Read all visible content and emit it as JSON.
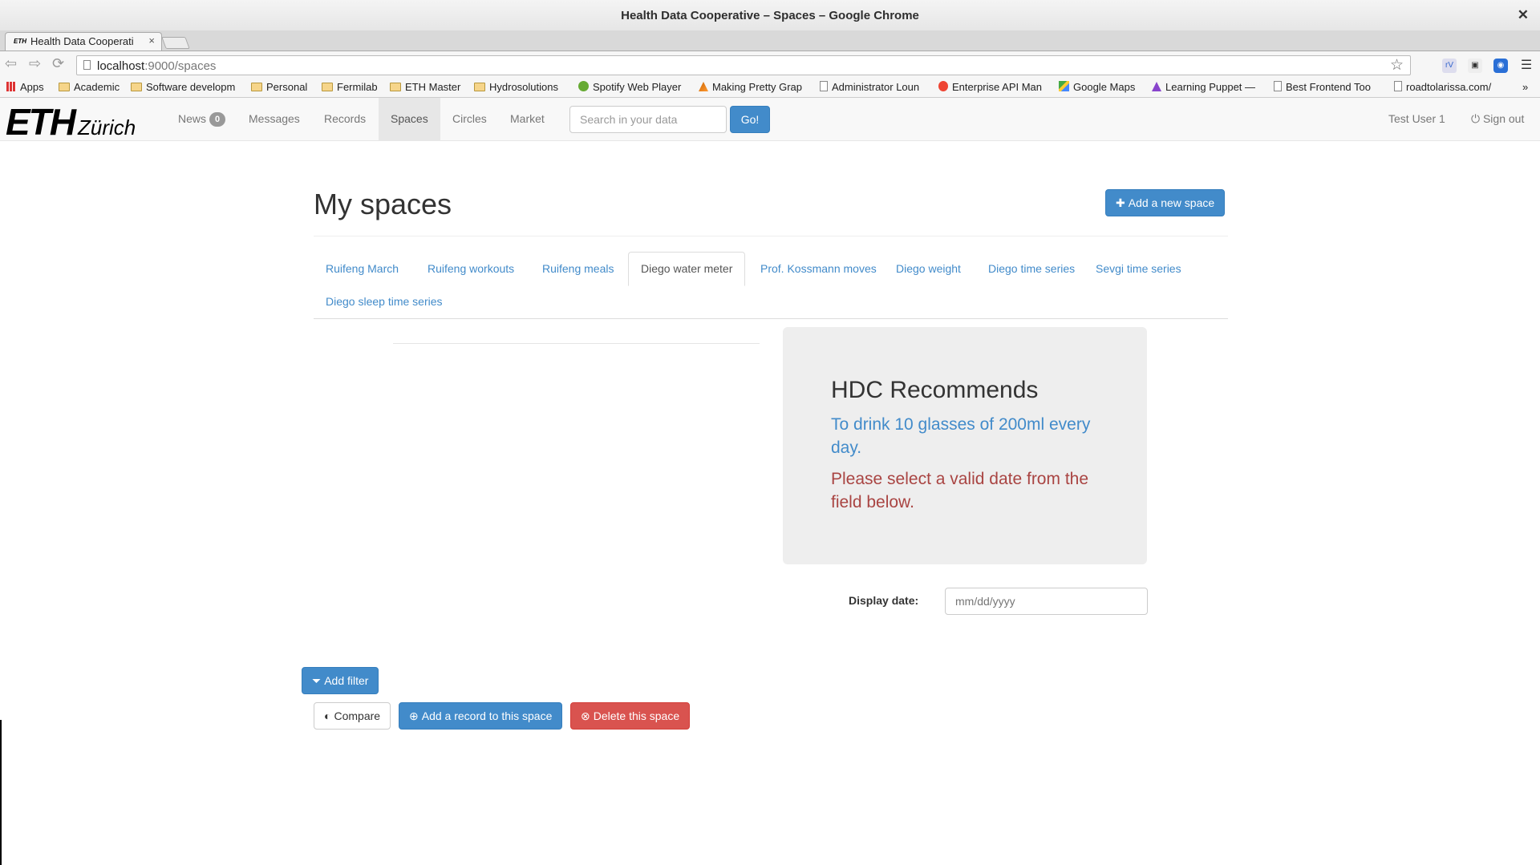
{
  "window": {
    "title": "Health Data Cooperative – Spaces – Google Chrome",
    "close_glyph": "✕"
  },
  "browser": {
    "tab": {
      "favicon_text": "ETH",
      "title": "Health Data Cooperati",
      "close_glyph": "×"
    },
    "url": {
      "host": "localhost",
      "path": ":9000/spaces"
    },
    "bookmarks": [
      {
        "label": "Apps",
        "icon": "apps-grid-icon"
      },
      {
        "label": "Academic",
        "icon": "folder-icon"
      },
      {
        "label": "Software developm",
        "icon": "folder-icon"
      },
      {
        "label": "Personal",
        "icon": "folder-icon"
      },
      {
        "label": "Fermilab",
        "icon": "folder-icon"
      },
      {
        "label": "ETH Master",
        "icon": "folder-icon"
      },
      {
        "label": "Hydrosolutions",
        "icon": "folder-icon"
      },
      {
        "label": "Spotify Web Player",
        "icon": "spotify-icon"
      },
      {
        "label": "Making Pretty Grap",
        "icon": "matlab-icon"
      },
      {
        "label": "Administrator Loun",
        "icon": "page-icon"
      },
      {
        "label": "Enterprise API Man",
        "icon": "api-icon"
      },
      {
        "label": "Google Maps",
        "icon": "maps-icon"
      },
      {
        "label": "Learning Puppet —",
        "icon": "puppet-icon"
      },
      {
        "label": "Best Frontend Too",
        "icon": "page-icon"
      },
      {
        "label": "roadtolarissa.com/",
        "icon": "page-icon"
      }
    ],
    "bookmarks_overflow": "»"
  },
  "navbar": {
    "logo_main": "ETH",
    "logo_sub": "Zürich",
    "items": [
      {
        "label": "News",
        "badge": "0"
      },
      {
        "label": "Messages"
      },
      {
        "label": "Records"
      },
      {
        "label": "Spaces"
      },
      {
        "label": "Circles"
      },
      {
        "label": "Market"
      }
    ],
    "search_placeholder": "Search in your data",
    "go_label": "Go!",
    "user": "Test User 1",
    "signout": "Sign out"
  },
  "page": {
    "title": "My spaces",
    "add_space_label": "Add a new space",
    "tabs": [
      "Ruifeng March",
      "Ruifeng workouts",
      "Ruifeng meals",
      "Diego water meter",
      "Prof. Kossmann moves",
      "Diego weight",
      "Diego time series",
      "Sevgi time series",
      "Diego sleep time series"
    ],
    "active_tab": "Diego water meter",
    "recommend": {
      "heading": "HDC Recommends",
      "text": "To drink 10 glasses of 200ml every day.",
      "error": "Please select a valid date from the field below."
    },
    "display_date_label": "Display date:",
    "date_placeholder": "mm/dd/yyyy",
    "buttons": {
      "add_filter": "Add filter",
      "compare": "Compare",
      "add_record": "Add a record to this space",
      "delete_space": "Delete this space"
    }
  },
  "colors": {
    "primary": "#428bca",
    "danger": "#d9534f",
    "error_text": "#a94442"
  }
}
